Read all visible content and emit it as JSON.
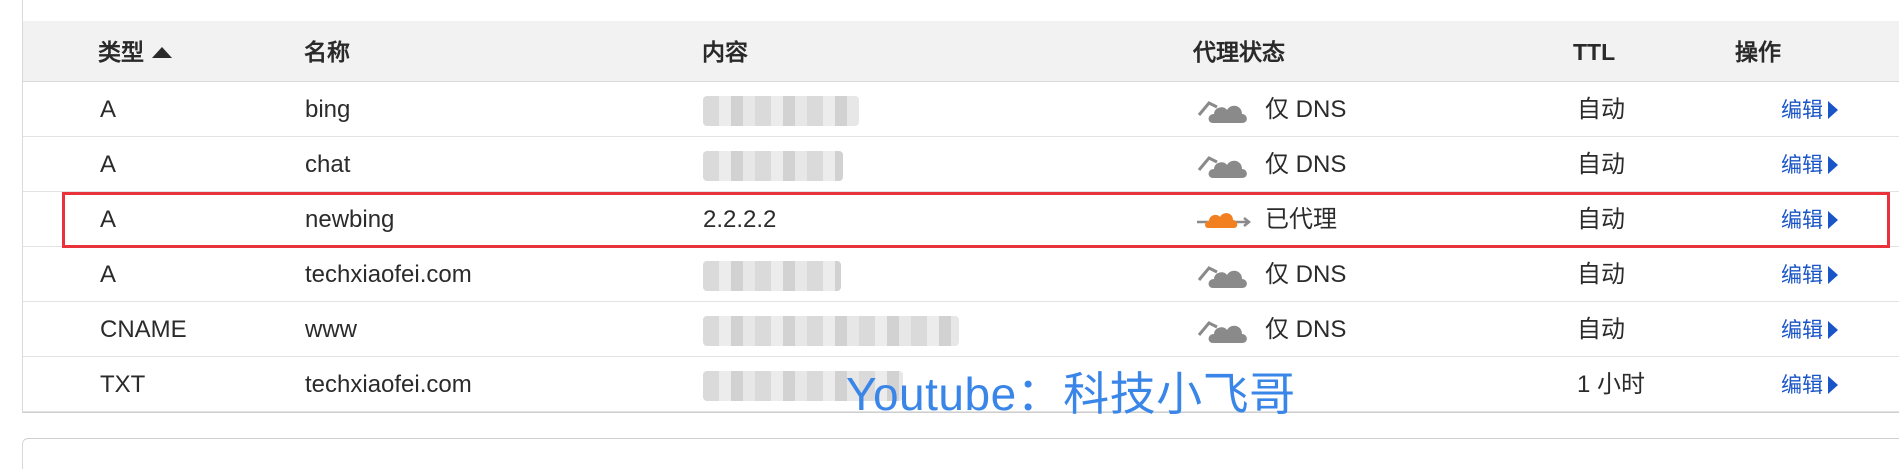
{
  "table": {
    "headers": {
      "type": "类型",
      "name": "名称",
      "content": "内容",
      "proxy_status": "代理状态",
      "ttl": "TTL",
      "actions": "操作"
    },
    "sort": {
      "column": "type",
      "direction": "ascending",
      "icon": "sort-up-icon"
    },
    "rows": [
      {
        "type": "A",
        "name": "bing",
        "content": "",
        "content_obscured": true,
        "proxy_icon": "dns-only-cloud-icon",
        "proxy": "仅 DNS",
        "ttl": "自动",
        "action": "编辑"
      },
      {
        "type": "A",
        "name": "chat",
        "content": "",
        "content_obscured": true,
        "proxy_icon": "dns-only-cloud-icon",
        "proxy": "仅 DNS",
        "ttl": "自动",
        "action": "编辑"
      },
      {
        "type": "A",
        "name": "newbing",
        "content": "2.2.2.2",
        "content_obscured": false,
        "proxy_icon": "proxied-cloud-icon",
        "proxy": "已代理",
        "ttl": "自动",
        "action": "编辑"
      },
      {
        "type": "A",
        "name": "techxiaofei.com",
        "content": "",
        "content_obscured": true,
        "proxy_icon": "dns-only-cloud-icon",
        "proxy": "仅 DNS",
        "ttl": "自动",
        "action": "编辑"
      },
      {
        "type": "CNAME",
        "name": "www",
        "content": "",
        "content_obscured": true,
        "proxy_icon": "dns-only-cloud-icon",
        "proxy": "仅 DNS",
        "ttl": "自动",
        "action": "编辑"
      },
      {
        "type": "TXT",
        "name": "techxiaofei.com",
        "content": "",
        "content_obscured": true,
        "proxy_icon": null,
        "proxy": "",
        "ttl": "1 小时",
        "action": "编辑"
      }
    ]
  },
  "watermark": "Youtube：科技小飞哥",
  "colors": {
    "link": "#1a55c8",
    "highlight_border": "#e8333a",
    "proxied_cloud": "#f38020",
    "dns_cloud": "#8a8a8a",
    "watermark": "#3a86e8"
  }
}
